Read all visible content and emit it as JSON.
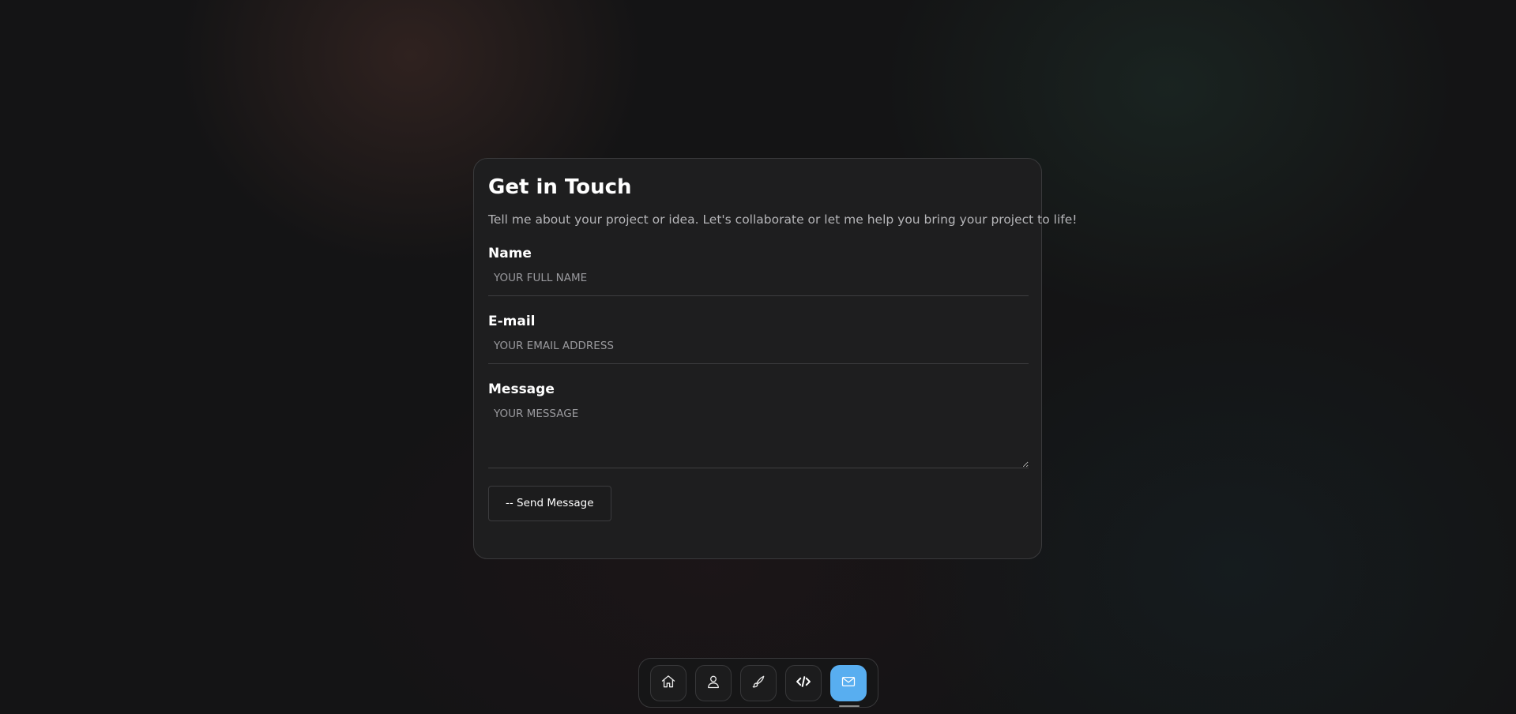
{
  "contact": {
    "title": "Get in Touch",
    "subtitle": "Tell me about your project or idea. Let's collaborate or let me help you bring your project to life!",
    "name_label": "Name",
    "name_placeholder": "YOUR FULL NAME",
    "email_label": "E-mail",
    "email_placeholder": "YOUR EMAIL ADDRESS",
    "message_label": "Message",
    "message_placeholder": "YOUR MESSAGE",
    "send_label": "-- Send Message"
  },
  "dock": {
    "items": [
      {
        "icon": "home-icon"
      },
      {
        "icon": "user-icon"
      },
      {
        "icon": "brush-icon"
      },
      {
        "icon": "code-icon"
      },
      {
        "icon": "mail-icon",
        "active": true
      }
    ]
  },
  "colors": {
    "accent": "#58aef0",
    "card_bg": "#1e1e1f",
    "page_bg": "#141415"
  }
}
